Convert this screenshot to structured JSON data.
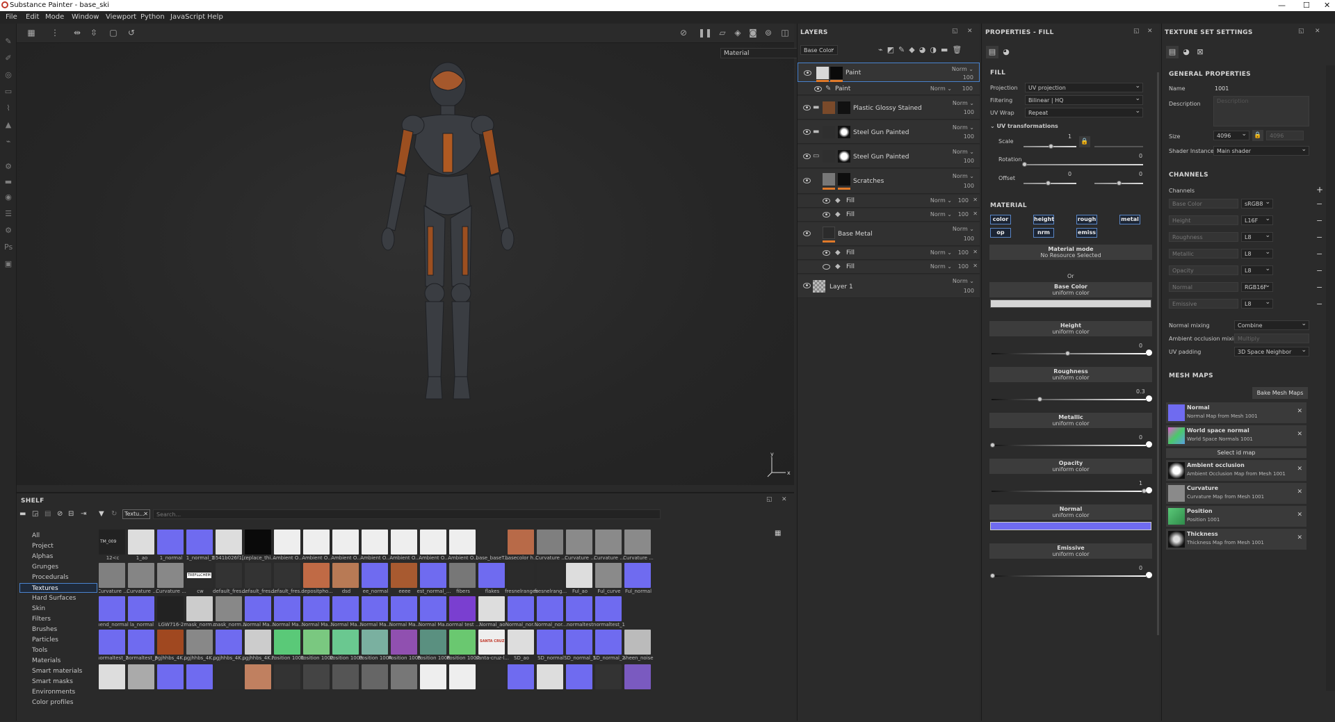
{
  "window": {
    "title": "Substance Painter - base_ski",
    "min": "—",
    "max": "☐",
    "close": "✕"
  },
  "menu": [
    "File",
    "Edit",
    "Mode",
    "Window",
    "Viewport",
    "Python",
    "JavaScript",
    "Help"
  ],
  "viewport": {
    "material_select": "Material",
    "gizmo_y": "y",
    "gizmo_x": "x"
  },
  "shelf": {
    "title": "SHELF",
    "filter_tag": "Textu...",
    "search_placeholder": "Search...",
    "categories": [
      "All",
      "Project",
      "Alphas",
      "Grunges",
      "Procedurals",
      "Textures",
      "Hard Surfaces",
      "Skin",
      "Filters",
      "Brushes",
      "Particles",
      "Tools",
      "Materials",
      "Smart materials",
      "Smart masks",
      "Environments",
      "Color profiles"
    ],
    "selected_category": "Textures",
    "row1": [
      "12<c",
      "1_ao",
      "1_normal",
      "1_normal_1",
      "6541b026f1...",
      "[replace_thi...",
      "Ambient O...",
      "Ambient O...",
      "Ambient O...",
      "Ambient O...",
      "Ambient O...",
      "Ambient O...",
      "Ambient O...",
      "base_baseT...",
      "basecolor h...",
      "Curvature ...",
      "Curvature ...",
      "Curvature ...",
      "Curvature ..."
    ],
    "row2": [
      "Curvature ...",
      "Curvature ...",
      "Curvature ...",
      "cw",
      "default_fres...",
      "default_fres...",
      "default_fres...",
      "depositpho...",
      "dsd",
      "ee_normal",
      "eeee",
      "est_normal_...",
      "fibers",
      "flakes",
      "fresnelranges",
      "fresnelrang...",
      "Ful_ao",
      "Ful_curve",
      "Ful_normal"
    ],
    "row3": [
      "hend_normal",
      "la_normal",
      "LGW716-2",
      "mask_norm...",
      "mask_norm...",
      "Normal Ma...",
      "Normal Ma...",
      "Normal Ma...",
      "Normal Ma...",
      "Normal Ma...",
      "Normal Ma...",
      "Normal Ma...",
      "normal test ...",
      "Normal_ao",
      "Normal_nor...",
      "Normal_nor...",
      "normaltest",
      "normaltest_1"
    ],
    "row4": [
      "normaltest_2",
      "normaltest_3",
      "pgjhhbs_4K...",
      "pgjhhbs_4K...",
      "pgjhhbs_4K...",
      "pgjhhbs_4K...",
      "Position 1001",
      "Position 1002",
      "Position 1003",
      "Position 1004",
      "Position 1005",
      "Position 1006",
      "Position 1007",
      "santa-cruz-l...",
      "SD_ao",
      "SD_normal",
      "SD_normal_1",
      "SD_normal_2",
      "sheen_noise"
    ],
    "thumb_text_tm": "TM_009",
    "thumb_text_treff": "TREFLLCHEM",
    "thumb_text_santa": "SANTA CRUZ"
  },
  "layers": {
    "title": "LAYERS",
    "channel_select": "Base Color",
    "items": [
      {
        "name": "Paint",
        "blend": "Norm",
        "opacity": "100"
      },
      {
        "name": "Paint",
        "blend": "Norm",
        "opacity": "100"
      },
      {
        "name": "Plastic Glossy Stained",
        "blend": "Norm",
        "opacity": "100"
      },
      {
        "name": "Steel Gun Painted",
        "blend": "Norm",
        "opacity": "100"
      },
      {
        "name": "Steel Gun Painted",
        "blend": "Norm",
        "opacity": "100"
      },
      {
        "name": "Scratches",
        "blend": "Norm",
        "opacity": "100"
      },
      {
        "name": "Fill",
        "blend": "Norm",
        "opacity": "100"
      },
      {
        "name": "Fill",
        "blend": "Norm",
        "opacity": "100"
      },
      {
        "name": "Base Metal",
        "blend": "Norm",
        "opacity": "100"
      },
      {
        "name": "Fill",
        "blend": "Norm",
        "opacity": "100"
      },
      {
        "name": "Fill",
        "blend": "Norm",
        "opacity": "100"
      },
      {
        "name": "Layer 1",
        "blend": "Norm",
        "opacity": "100"
      }
    ]
  },
  "properties": {
    "title": "PROPERTIES - FILL",
    "fill_header": "FILL",
    "projection_label": "Projection",
    "projection_value": "UV projection",
    "filtering_label": "Filtering",
    "filtering_value": "Bilinear | HQ",
    "uvwrap_label": "UV Wrap",
    "uvwrap_value": "Repeat",
    "uvt_header": "UV transformations",
    "scale_label": "Scale",
    "scale_value": "1",
    "rotation_label": "Rotation",
    "rotation_value": "0",
    "offset_label": "Offset",
    "offset_value1": "0",
    "offset_value2": "0",
    "material_header": "MATERIAL",
    "channel_buttons": [
      "color",
      "height",
      "rough",
      "metal",
      "op",
      "nrm",
      "emiss"
    ],
    "material_mode_title": "Material mode",
    "material_mode_value": "No Resource Selected",
    "or_text": "Or",
    "uniform": "uniform color",
    "channels": [
      {
        "name": "Base Color",
        "value": ""
      },
      {
        "name": "Height",
        "value": "0"
      },
      {
        "name": "Roughness",
        "value": "0.3"
      },
      {
        "name": "Metallic",
        "value": "0"
      },
      {
        "name": "Opacity",
        "value": "1"
      },
      {
        "name": "Normal",
        "value": ""
      },
      {
        "name": "Emissive",
        "value": "0"
      }
    ],
    "normal_color": "#6f6bf0"
  },
  "tss": {
    "title": "TEXTURE SET SETTINGS",
    "general_header": "GENERAL PROPERTIES",
    "name_label": "Name",
    "name_value": "1001",
    "description_label": "Description",
    "description_placeholder": "Description",
    "size_label": "Size",
    "size_value": "4096",
    "size_value2": "4096",
    "shader_label": "Shader Instance",
    "shader_value": "Main shader",
    "channels_header": "CHANNELS",
    "channels_label": "Channels",
    "channels": [
      {
        "name": "Base Color",
        "format": "sRGB8"
      },
      {
        "name": "Height",
        "format": "L16F"
      },
      {
        "name": "Roughness",
        "format": "L8"
      },
      {
        "name": "Metallic",
        "format": "L8"
      },
      {
        "name": "Opacity",
        "format": "L8"
      },
      {
        "name": "Normal",
        "format": "RGB16F"
      },
      {
        "name": "Emissive",
        "format": "L8"
      }
    ],
    "normal_mixing_label": "Normal mixing",
    "normal_mixing_value": "Combine",
    "ao_mixing_label": "Ambient occlusion mixing",
    "ao_mixing_value": "Multiply",
    "uv_padding_label": "UV padding",
    "uv_padding_value": "3D Space Neighbor",
    "mesh_maps_header": "MESH MAPS",
    "bake_button": "Bake Mesh Maps",
    "select_id_map": "Select id map",
    "mesh_maps": [
      {
        "name": "Normal",
        "sub": "Normal Map from Mesh 1001"
      },
      {
        "name": "World space normal",
        "sub": "World Space Normals 1001"
      },
      {
        "name": "Ambient occlusion",
        "sub": "Ambient Occlusion Map from Mesh 1001"
      },
      {
        "name": "Curvature",
        "sub": "Curvature Map from Mesh 1001"
      },
      {
        "name": "Position",
        "sub": "Position 1001"
      },
      {
        "name": "Thickness",
        "sub": "Thickness Map from Mesh 1001"
      }
    ]
  },
  "colors": {
    "accent": "#e07a2a",
    "select_blue": "#4a84d0",
    "panel": "#2b2b2b"
  }
}
